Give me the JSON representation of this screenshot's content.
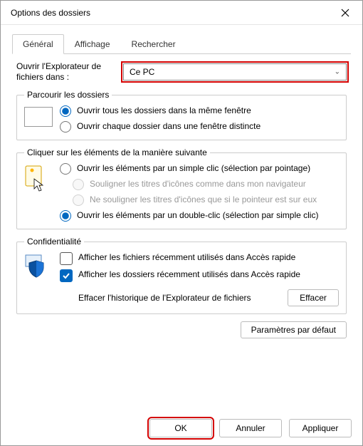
{
  "window": {
    "title": "Options des dossiers",
    "close_tooltip": "Fermer"
  },
  "tabs": {
    "general": "Général",
    "view": "Affichage",
    "search": "Rechercher"
  },
  "open_in": {
    "label": "Ouvrir l'Explorateur de fichiers dans :",
    "value": "Ce PC"
  },
  "browse": {
    "legend": "Parcourir les dossiers",
    "same_window": "Ouvrir tous les dossiers dans la même fenêtre",
    "distinct_window": "Ouvrir chaque dossier dans une fenêtre distincte",
    "selected": "same_window"
  },
  "click": {
    "legend": "Cliquer sur les éléments de la manière suivante",
    "single": "Ouvrir les éléments par un simple clic (sélection par pointage)",
    "underline_browser": "Souligner les titres d'icônes comme dans mon navigateur",
    "underline_hover": "Ne souligner les titres d'icônes que si le pointeur est sur eux",
    "double": "Ouvrir les éléments par un double-clic (sélection par simple clic)",
    "selected": "double"
  },
  "privacy": {
    "legend": "Confidentialité",
    "recent_files": "Afficher les fichiers récemment utilisés dans Accès rapide",
    "recent_folders": "Afficher les dossiers récemment utilisés dans Accès rapide",
    "recent_files_checked": false,
    "recent_folders_checked": true,
    "clear_label": "Effacer l'historique de l'Explorateur de fichiers",
    "clear_btn": "Effacer"
  },
  "defaults_btn": "Paramètres par défaut",
  "buttons": {
    "ok": "OK",
    "cancel": "Annuler",
    "apply": "Appliquer"
  }
}
